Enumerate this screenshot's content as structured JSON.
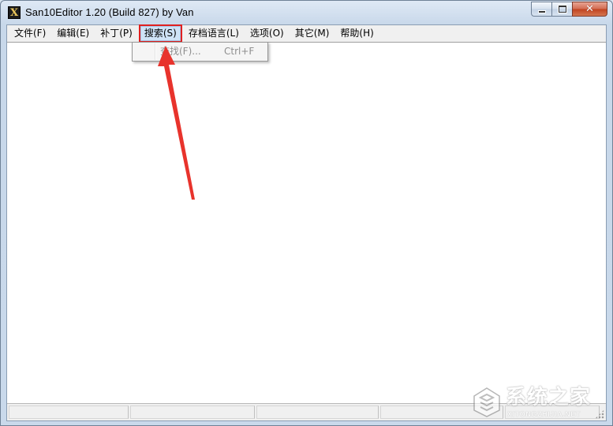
{
  "window": {
    "title": "San10Editor 1.20 (Build 827) by Van",
    "app_icon_glyph": "X"
  },
  "caption_buttons": {
    "minimize_icon": "minimize-icon",
    "maximize_icon": "maximize-icon",
    "close_icon": "close-icon",
    "close_glyph": "✕"
  },
  "menubar": {
    "items": [
      {
        "label": "文件(F)"
      },
      {
        "label": "编辑(E)"
      },
      {
        "label": "补丁(P)"
      },
      {
        "label": "搜索(S)"
      },
      {
        "label": "存档语言(L)"
      },
      {
        "label": "选项(O)"
      },
      {
        "label": "其它(M)"
      },
      {
        "label": "帮助(H)"
      }
    ],
    "active_index": 3
  },
  "search_menu": {
    "items": [
      {
        "label": "查找(F)...",
        "shortcut": "Ctrl+F",
        "enabled": false
      }
    ]
  },
  "statusbar": {
    "panes": [
      "",
      "",
      "",
      "",
      ""
    ]
  },
  "watermark": {
    "title": "系统之家",
    "subtitle": "XITONGZHIJIA.NET"
  },
  "colors": {
    "highlight_outline": "#e02020",
    "arrow": "#e8332c",
    "disabled_text": "#8e8e8e"
  }
}
